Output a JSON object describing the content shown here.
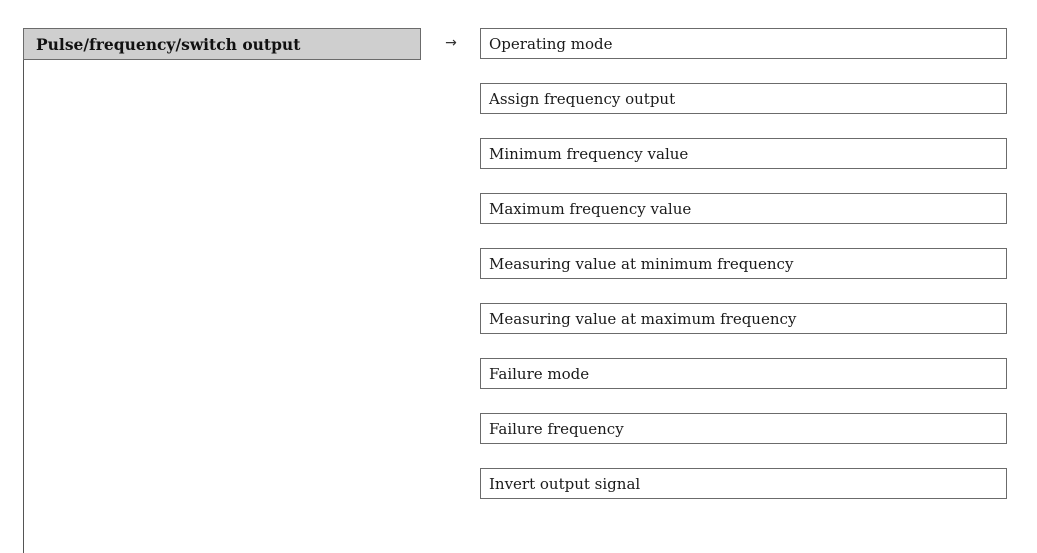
{
  "menu": {
    "title": "Pulse/frequency/switch output",
    "arrow": "→"
  },
  "parameters": [
    "Operating mode",
    "Assign frequency output",
    "Minimum frequency value",
    "Maximum frequency value",
    "Measuring value at minimum frequency",
    "Measuring value at maximum frequency",
    "Failure mode",
    "Failure frequency",
    "Invert output signal"
  ]
}
